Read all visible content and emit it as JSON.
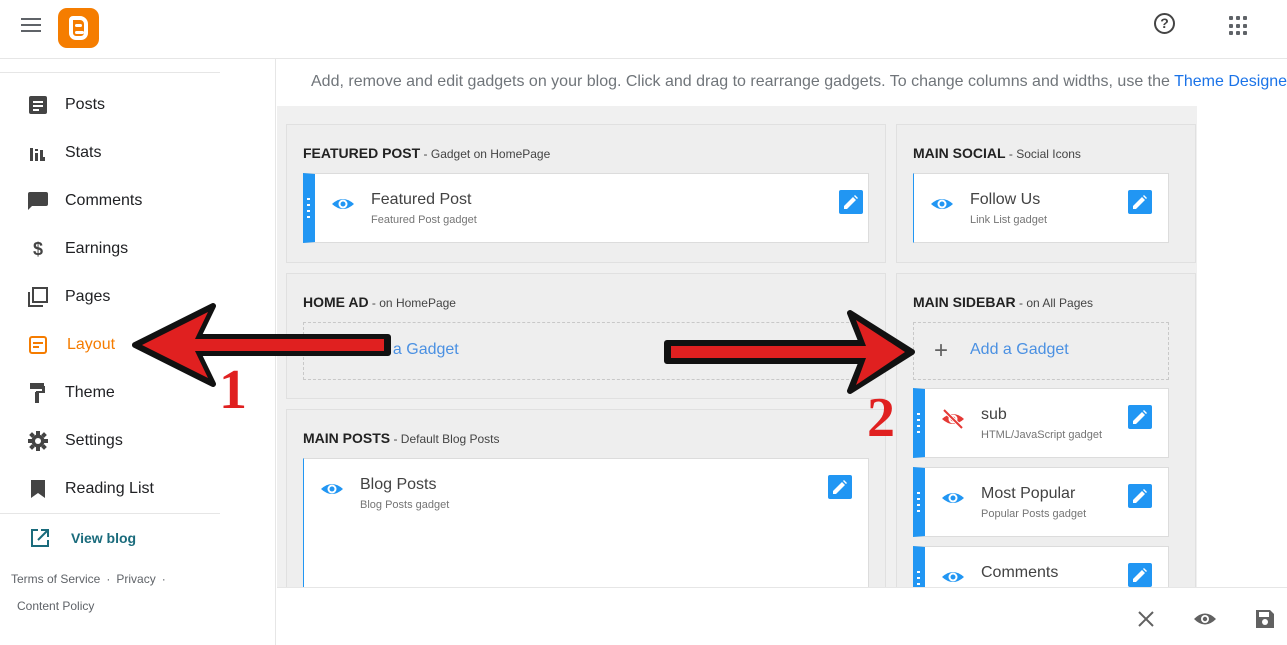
{
  "header": {
    "menu_icon": "hamburger-menu-icon",
    "logo_icon": "blogger-logo-icon",
    "help_icon": "help-circle-icon",
    "apps_icon": "apps-grid-icon",
    "help_glyph": "?"
  },
  "sidebar": {
    "items": [
      {
        "label": "Posts",
        "icon": "posts-icon"
      },
      {
        "label": "Stats",
        "icon": "stats-icon"
      },
      {
        "label": "Comments",
        "icon": "comments-icon"
      },
      {
        "label": "Earnings",
        "icon": "dollar-icon"
      },
      {
        "label": "Pages",
        "icon": "pages-icon"
      },
      {
        "label": "Layout",
        "icon": "layout-icon",
        "active": true
      },
      {
        "label": "Theme",
        "icon": "paint-roller-icon"
      },
      {
        "label": "Settings",
        "icon": "gear-icon"
      },
      {
        "label": "Reading List",
        "icon": "bookmark-icon"
      }
    ],
    "view_blog": "View blog",
    "footer": {
      "terms": "Terms of Service",
      "privacy": "Privacy",
      "content_policy": "Content Policy",
      "separator": "·"
    }
  },
  "main": {
    "info_text": "Add, remove and edit gadgets on your blog. Click and drag to rearrange gadgets. To change columns and widths, use the ",
    "info_link": "Theme Designer",
    "info_tail": ".",
    "sections": {
      "featured": {
        "title": "FEATURED POST",
        "subtitle": " - Gadget on HomePage",
        "gadget": {
          "title": "Featured Post",
          "sub": "Featured Post gadget"
        }
      },
      "social": {
        "title": "MAIN SOCIAL",
        "subtitle": " - Social Icons",
        "gadget": {
          "title": "Follow Us",
          "sub": "Link List gadget"
        }
      },
      "homead": {
        "title": "HOME AD",
        "subtitle": " - on HomePage",
        "add": "Add a Gadget"
      },
      "sidebar": {
        "title": "MAIN SIDEBAR",
        "subtitle": " - on All Pages",
        "add": "Add a Gadget",
        "gadgets": [
          {
            "title": "sub",
            "sub": "HTML/JavaScript gadget",
            "hidden": true
          },
          {
            "title": "Most Popular",
            "sub": "Popular Posts gadget"
          },
          {
            "title": "Comments",
            "sub": ""
          }
        ]
      },
      "posts": {
        "title": "MAIN POSTS",
        "subtitle": " - Default Blog Posts",
        "gadget": {
          "title": "Blog Posts",
          "sub": "Blog Posts gadget"
        }
      }
    },
    "plus_glyph": "+"
  },
  "bottombar": {
    "close_icon": "close-icon",
    "preview_icon": "eye-icon",
    "save_icon": "save-icon"
  },
  "annotations": {
    "label_1": "1",
    "label_2": "2",
    "color": "#e02020"
  }
}
